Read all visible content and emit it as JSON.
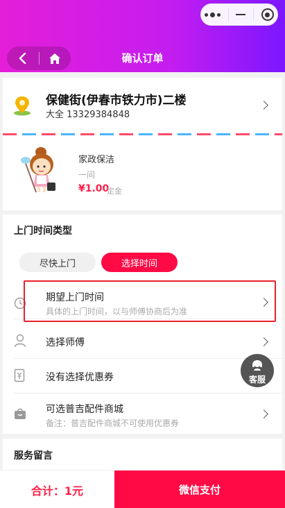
{
  "header": {
    "title": "确认订单",
    "gradient_colors": [
      "#e51ed8",
      "#7b17ff"
    ],
    "icons": {
      "back": "back-arrow-icon",
      "home": "home-icon",
      "more": "more-dots-icon",
      "minimize": "minimize-icon",
      "close": "target-close-icon"
    }
  },
  "address": {
    "name": "保健街(伊春市铁力市)二楼",
    "contact": "大全 13329384848",
    "icon": "location-pin-icon"
  },
  "service": {
    "name": "家政保洁",
    "unit": "一间",
    "price": "¥1.00",
    "deposit_label": "定金"
  },
  "time_type": {
    "title": "上门时间类型",
    "options": [
      {
        "label": "尽快上门",
        "selected": false
      },
      {
        "label": "选择时间",
        "selected": true
      }
    ]
  },
  "rows": {
    "expected_time": {
      "title": "期望上门时间",
      "subtitle": "具体的上门时间，以与师傅协商后为准",
      "icon": "clock-icon"
    },
    "worker": {
      "title": "选择师傅",
      "icon": "person-icon"
    },
    "coupon": {
      "title": "没有选择优惠券",
      "icon": "coupon-icon"
    },
    "parts_mall": {
      "title": "可选普吉配件商城",
      "subtitle": "备注：普吉配件商城不可使用优惠券",
      "icon": "bag-icon"
    }
  },
  "customer_service": {
    "label": "客服",
    "icon": "headset-icon"
  },
  "message": {
    "title": "服务留言"
  },
  "footer": {
    "total": "合计：1元",
    "pay_button": "微信支付",
    "accent_color": "#ff0a45"
  }
}
